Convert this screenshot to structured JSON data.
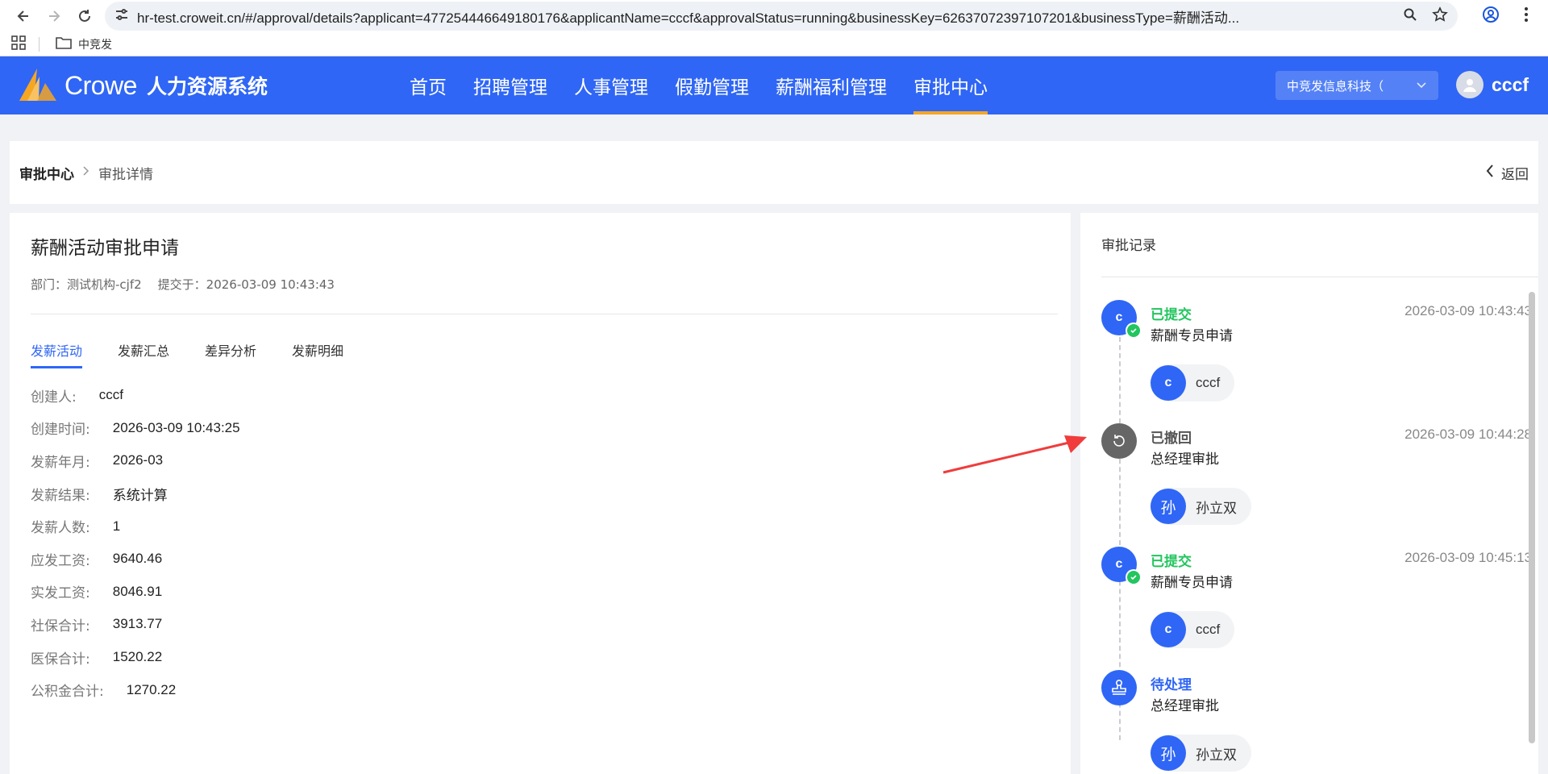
{
  "browser": {
    "url": "hr-test.croweit.cn/#/approval/details?applicant=477254446649180176&applicantName=cccf&approvalStatus=running&businessKey=62637072397107201&businessType=薪酬活动...",
    "bookmark_label": "中竞发"
  },
  "header": {
    "logo_text": "Crowe",
    "system_name": "人力资源系统",
    "nav": [
      "首页",
      "招聘管理",
      "人事管理",
      "假勤管理",
      "薪酬福利管理",
      "审批中心"
    ],
    "active_nav": "审批中心",
    "company": "中竞发信息科技（",
    "user": "cccf",
    "accent_color": "#2f66f5",
    "active_underline_color": "#f5a623"
  },
  "breadcrumb": {
    "root": "审批中心",
    "current": "审批详情",
    "back_label": "返回"
  },
  "form": {
    "title": "薪酬活动审批申请",
    "department": "部门：测试机构-cjf2",
    "submitted": "提交于：2026-03-09 10:43:43",
    "tabs": [
      "发薪活动",
      "发薪汇总",
      "差异分析",
      "发薪明细"
    ],
    "fields": [
      {
        "label": "创建人:",
        "value": "cccf"
      },
      {
        "label": "创建时间:",
        "value": "2026-03-09 10:43:25"
      },
      {
        "label": "发薪年月:",
        "value": "2026-03"
      },
      {
        "label": "发薪结果:",
        "value": "系统计算"
      },
      {
        "label": "发薪人数:",
        "value": "1"
      },
      {
        "label": "应发工资:",
        "value": "9640.46"
      },
      {
        "label": "实发工资:",
        "value": "8046.91"
      },
      {
        "label": "社保合计:",
        "value": "3913.77"
      },
      {
        "label": "医保合计:",
        "value": "1520.22"
      },
      {
        "label": "公积金合计:",
        "value": "1270.22"
      }
    ]
  },
  "record": {
    "title": "审批记录",
    "entries": [
      {
        "avatar": "c",
        "status": "已提交",
        "status_color": "green",
        "node": "薪酬专员申请",
        "time": "2026-03-09 10:43:43",
        "person_avatar": "c",
        "person": "cccf"
      },
      {
        "avatar": "revoke-icon",
        "status": "已撤回",
        "status_color": "gray",
        "node": "总经理审批",
        "time": "2026-03-09 10:44:28",
        "person_avatar": "孙",
        "person": "孙立双"
      },
      {
        "avatar": "c",
        "status": "已提交",
        "status_color": "green",
        "node": "薪酬专员申请",
        "time": "2026-03-09 10:45:13",
        "person_avatar": "c",
        "person": "cccf"
      },
      {
        "avatar": "stamp-icon",
        "status": "待处理",
        "status_color": "blue",
        "node": "总经理审批",
        "time": "",
        "person_avatar": "孙",
        "person": "孙立双"
      }
    ]
  }
}
